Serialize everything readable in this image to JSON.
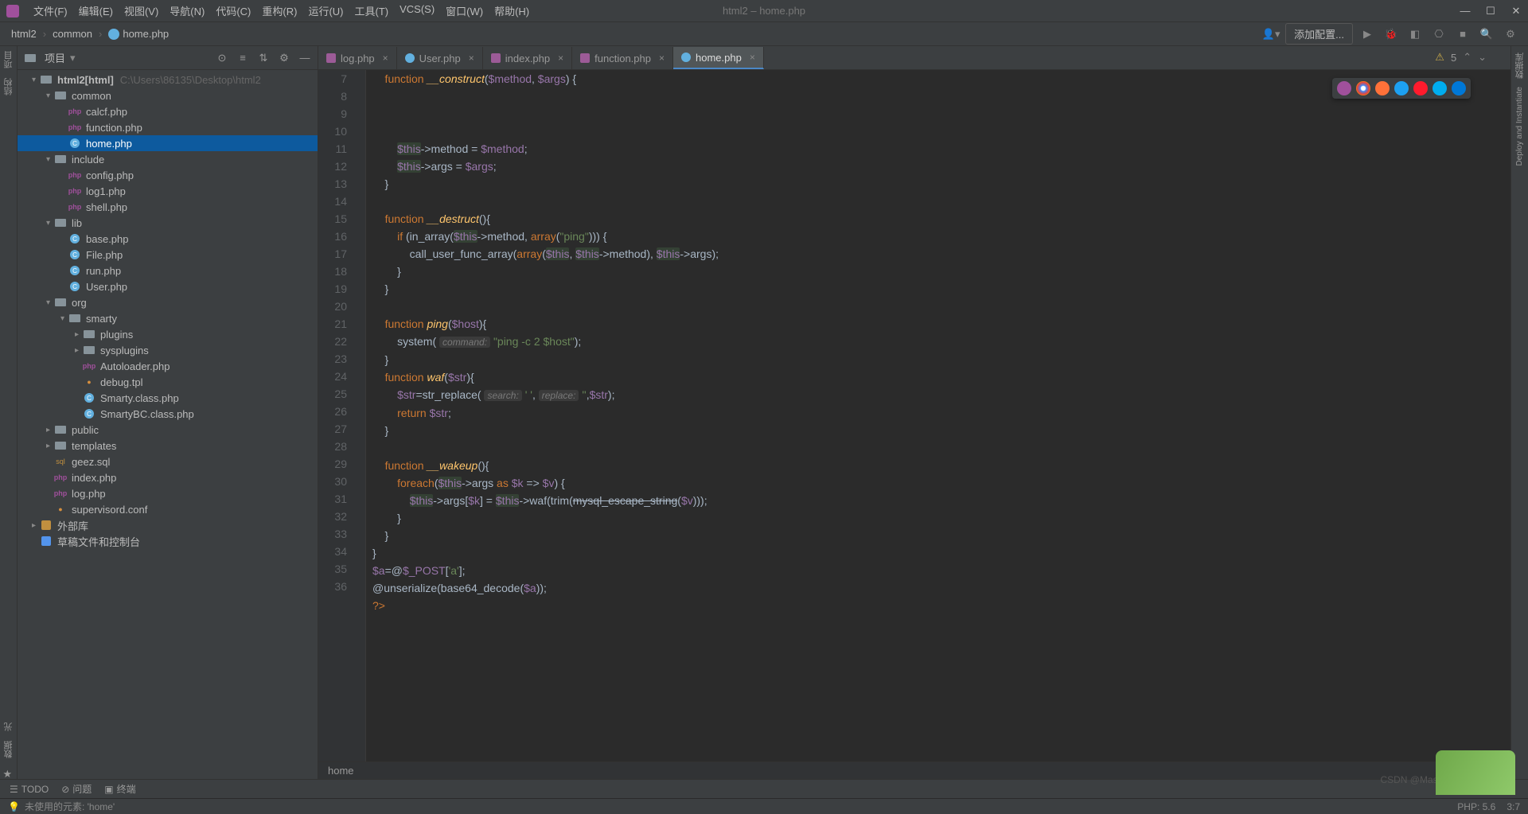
{
  "window": {
    "title": "html2 – home.php"
  },
  "menus": [
    "文件(F)",
    "编辑(E)",
    "视图(V)",
    "导航(N)",
    "代码(C)",
    "重构(R)",
    "运行(U)",
    "工具(T)",
    "VCS(S)",
    "窗口(W)",
    "帮助(H)"
  ],
  "breadcrumb": {
    "root": "html2",
    "mid": "common",
    "file": "home.php"
  },
  "navbar": {
    "add_config": "添加配置..."
  },
  "panel": {
    "title": "项目"
  },
  "tree": {
    "root": {
      "name": "html2",
      "tag": "[html]",
      "path": "C:\\Users\\86135\\Desktop\\html2"
    },
    "items": [
      {
        "indent": 1,
        "chev": "▾",
        "icon": "folder",
        "label": "common"
      },
      {
        "indent": 2,
        "icon": "php",
        "label": "calcf.php"
      },
      {
        "indent": 2,
        "icon": "php",
        "label": "function.php"
      },
      {
        "indent": 2,
        "icon": "c",
        "label": "home.php",
        "selected": true
      },
      {
        "indent": 1,
        "chev": "▾",
        "icon": "folder",
        "label": "include"
      },
      {
        "indent": 2,
        "icon": "php",
        "label": "config.php"
      },
      {
        "indent": 2,
        "icon": "php",
        "label": "log1.php"
      },
      {
        "indent": 2,
        "icon": "php",
        "label": "shell.php"
      },
      {
        "indent": 1,
        "chev": "▾",
        "icon": "folder",
        "label": "lib"
      },
      {
        "indent": 2,
        "icon": "c",
        "label": "base.php"
      },
      {
        "indent": 2,
        "icon": "c",
        "label": "File.php"
      },
      {
        "indent": 2,
        "icon": "c",
        "label": "run.php"
      },
      {
        "indent": 2,
        "icon": "c",
        "label": "User.php"
      },
      {
        "indent": 1,
        "chev": "▾",
        "icon": "folder",
        "label": "org"
      },
      {
        "indent": 2,
        "chev": "▾",
        "icon": "folder",
        "label": "smarty"
      },
      {
        "indent": 3,
        "chev": "▸",
        "icon": "folder",
        "label": "plugins"
      },
      {
        "indent": 3,
        "chev": "▸",
        "icon": "folder",
        "label": "sysplugins"
      },
      {
        "indent": 3,
        "icon": "php",
        "label": "Autoloader.php"
      },
      {
        "indent": 3,
        "icon": "tpl",
        "label": "debug.tpl"
      },
      {
        "indent": 3,
        "icon": "c",
        "label": "Smarty.class.php"
      },
      {
        "indent": 3,
        "icon": "c",
        "label": "SmartyBC.class.php"
      },
      {
        "indent": 1,
        "chev": "▸",
        "icon": "folder",
        "label": "public"
      },
      {
        "indent": 1,
        "chev": "▸",
        "icon": "folder",
        "label": "templates"
      },
      {
        "indent": 1,
        "icon": "sql",
        "label": "geez.sql"
      },
      {
        "indent": 1,
        "icon": "php",
        "label": "index.php"
      },
      {
        "indent": 1,
        "icon": "php",
        "label": "log.php"
      },
      {
        "indent": 1,
        "icon": "tpl",
        "label": "supervisord.conf"
      }
    ],
    "ext_lib": "外部库",
    "scratch": "草稿文件和控制台"
  },
  "tabs": [
    {
      "icon": "php",
      "label": "log.php"
    },
    {
      "icon": "c",
      "label": "User.php"
    },
    {
      "icon": "php",
      "label": "index.php"
    },
    {
      "icon": "php",
      "label": "function.php"
    },
    {
      "icon": "c",
      "label": "home.php",
      "active": true
    }
  ],
  "inspections": {
    "warnings": "5"
  },
  "line_start": 7,
  "line_end": 36,
  "code_breadcrumb": "home",
  "status": {
    "todo": "TODO",
    "problems": "问题",
    "terminal": "终端"
  },
  "footer": {
    "msg": "未使用的元素: 'home'",
    "php": "PHP: 5.6",
    "pos": "3:7"
  },
  "left_gutter": [
    "项目",
    "结构",
    "光",
    "数据"
  ],
  "right_gutter": [
    "数据库",
    "Deploy and Instantiate"
  ],
  "watermark": "CSDN @Maserati"
}
